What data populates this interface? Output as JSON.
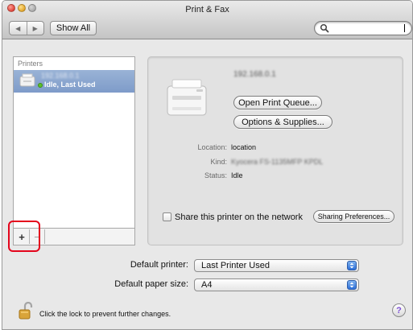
{
  "window": {
    "title": "Print & Fax"
  },
  "toolbar": {
    "show_all_label": "Show All",
    "back_glyph": "◀",
    "forward_glyph": "▶",
    "search_value": "",
    "search_icon": "magnifier-icon"
  },
  "printers": {
    "header": "Printers",
    "items": [
      {
        "name": "192.168.0.1",
        "status": "Idle, Last Used",
        "selected": true
      }
    ],
    "add_glyph": "+",
    "remove_glyph": "−"
  },
  "detail": {
    "printer_ip": "192.168.0.1",
    "open_queue_label": "Open Print Queue...",
    "options_supplies_label": "Options & Supplies...",
    "location_label": "Location:",
    "location_value": "location",
    "kind_label": "Kind:",
    "kind_value": "Kyocera FS-1135MFP KPDL",
    "status_label": "Status:",
    "status_value": "Idle",
    "share_label": "Share this printer on the network",
    "share_checked": false,
    "sharing_prefs_label": "Sharing Preferences..."
  },
  "defaults": {
    "default_printer_label": "Default printer:",
    "default_printer_value": "Last Printer Used",
    "default_paper_label": "Default paper size:",
    "default_paper_value": "A4"
  },
  "footer": {
    "lock_text": "Click the lock to prevent further changes.",
    "help_glyph": "?"
  },
  "colors": {
    "selection": "#8aa6cf",
    "highlight_box": "#e4051c",
    "status_idle": "#5cbf2a"
  }
}
